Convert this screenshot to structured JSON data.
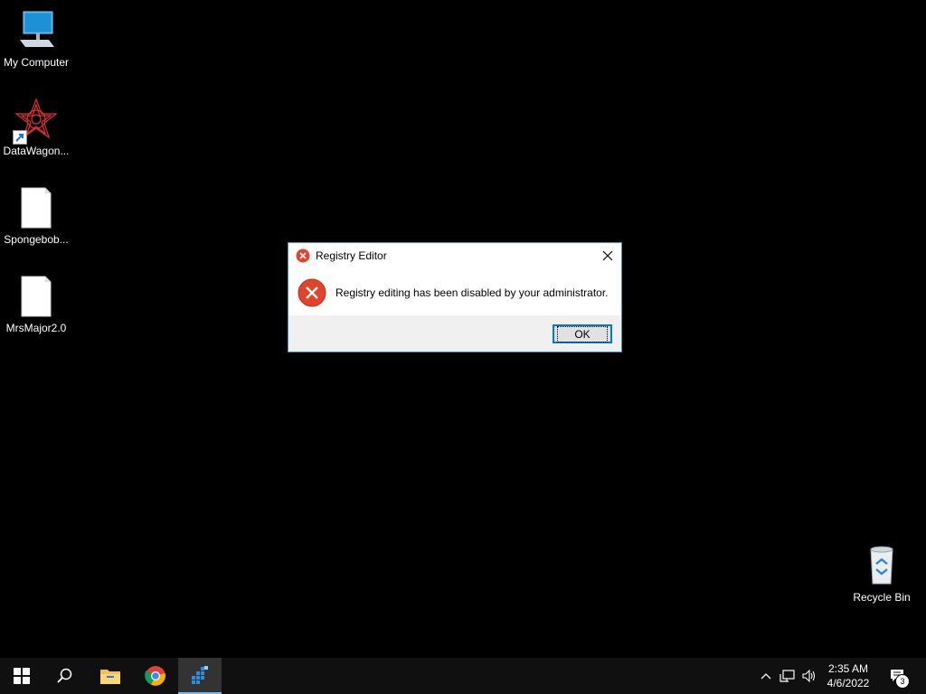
{
  "desktop": {
    "icons": [
      {
        "label": "My Computer",
        "icon": "monitor-icon"
      },
      {
        "label": "DataWagon...",
        "icon": "red-star-icon"
      },
      {
        "label": "Spongebob...",
        "icon": "file-icon"
      },
      {
        "label": "MrsMajor2.0",
        "icon": "file-icon"
      },
      {
        "label": "Recycle Bin",
        "icon": "recycle-bin-icon"
      }
    ]
  },
  "dialog": {
    "title": "Registry Editor",
    "message": "Registry editing has been disabled by your administrator.",
    "ok_label": "OK"
  },
  "taskbar": {
    "apps": [
      "windows-start-icon",
      "search-icon",
      "file-explorer-icon",
      "chrome-icon",
      "registry-editor-icon"
    ],
    "clock": {
      "time": "2:35 AM",
      "date": "4/6/2022"
    },
    "notifications_count": "3"
  },
  "colors": {
    "error_red": "#e0442b",
    "accent_blue": "#0078d7",
    "taskbar_bg": "#101010"
  }
}
